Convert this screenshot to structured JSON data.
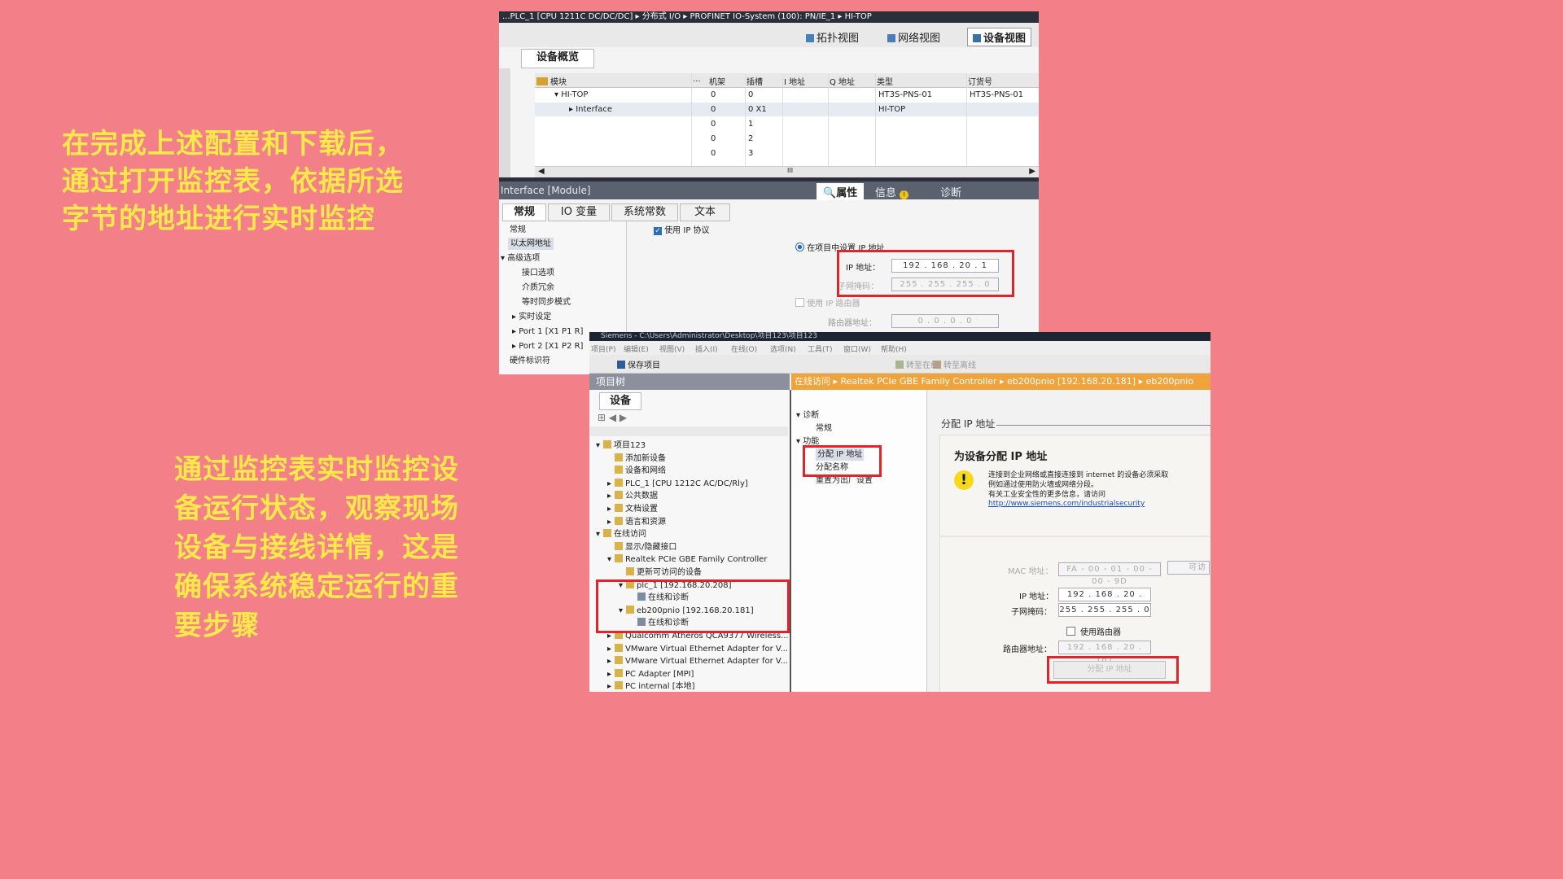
{
  "left_text_top": [
    "在完成上述配置和下载后，",
    "通过打开监控表，依据所选",
    "字节的地址进行实时监控"
  ],
  "left_text_bottom": [
    "通过监控表实时监控设",
    "备运行状态，观察现场",
    "设备与接线详情，这是",
    "确保系统稳定运行的重",
    "要步骤"
  ],
  "colors": {
    "background": "#f37f88",
    "text": "#ffe94a",
    "highlight": "#e0252a",
    "toolbar_bar": "#f0a33a"
  },
  "screen1": {
    "breadcrumb": "...PLC_1 [CPU 1211C DC/DC/DC] ▸ 分布式 I/O ▸ PROFINET IO-System (100): PN/IE_1 ▸ HI-TOP",
    "view_buttons": [
      "拓扑视图",
      "网络视图",
      "设备视图"
    ],
    "overview_tab": "设备概览",
    "columns": [
      "模块",
      "...",
      "机架",
      "插槽",
      "I 地址",
      "Q 地址",
      "类型",
      "订货号"
    ],
    "rows": [
      {
        "module": "HI-TOP",
        "rack": "0",
        "slot": "0",
        "type": "HT3S-PNS-01",
        "order": "HT3S-PNS-01"
      },
      {
        "module": "Interface",
        "rack": "0",
        "slot": "0 X1",
        "type": "HI-TOP",
        "order": ""
      },
      {
        "module": "",
        "rack": "0",
        "slot": "1",
        "type": "",
        "order": ""
      },
      {
        "module": "",
        "rack": "0",
        "slot": "2",
        "type": "",
        "order": ""
      },
      {
        "module": "",
        "rack": "0",
        "slot": "3",
        "type": "",
        "order": ""
      }
    ],
    "scroll_mark": "III",
    "inspector_title": "Interface [Module]",
    "inspector_tabs": [
      "属性",
      "信息",
      "诊断"
    ],
    "prop_tabs": [
      "常规",
      "IO 变量",
      "系统常数",
      "文本"
    ],
    "nav": [
      "常规",
      "以太网地址",
      "高级选项",
      "接口选项",
      "介质冗余",
      "等时同步模式",
      "实时设定",
      "Port 1 [X1 P1 R]",
      "Port 2 [X1 P2 R]",
      "硬件标识符"
    ],
    "use_ip_protocol": "使用 IP 协议",
    "set_ip_in_project": "在项目中设置 IP 地址",
    "ip_label": "IP 地址：",
    "ip_value": "192 . 168 . 20 . 1",
    "subnet_label": "子网掩码：",
    "subnet_value": "255 . 255 . 255 . 0",
    "use_router": "使用 IP 路由器",
    "router_label": "路由器地址：",
    "router_value": "0 . 0 . 0 . 0"
  },
  "screen2": {
    "titlebar": "Siemens - C:\\Users\\Administrator\\Desktop\\项目123\\项目123",
    "menu": [
      "项目(P)",
      "编辑(E)",
      "视图(V)",
      "插入(I)",
      "在线(O)",
      "选项(N)",
      "工具(T)",
      "窗口(W)",
      "帮助(H)"
    ],
    "toolbar_labels": [
      "保存项目",
      "转至在线",
      "转至离线"
    ],
    "project_tree_title": "项目树",
    "devices_tab": "设备",
    "tree": [
      {
        "label": "项目123",
        "indent": 1
      },
      {
        "label": "添加新设备",
        "indent": 2
      },
      {
        "label": "设备和网络",
        "indent": 2
      },
      {
        "label": "PLC_1 [CPU 1212C AC/DC/Rly]",
        "indent": 2
      },
      {
        "label": "公共数据",
        "indent": 2
      },
      {
        "label": "文档设置",
        "indent": 2
      },
      {
        "label": "语言和资源",
        "indent": 2
      },
      {
        "label": "在线访问",
        "indent": 1
      },
      {
        "label": "显示/隐藏接口",
        "indent": 2
      },
      {
        "label": "Realtek PCIe GBE Family Controller",
        "indent": 2
      },
      {
        "label": "更新可访问的设备",
        "indent": 3
      },
      {
        "label": "plc_1 [192.168.20.208]",
        "indent": 3
      },
      {
        "label": "在线和诊断",
        "indent": 4
      },
      {
        "label": "eb200pnio [192.168.20.181]",
        "indent": 3
      },
      {
        "label": "在线和诊断",
        "indent": 4
      },
      {
        "label": "Qualcomm Atheros QCA9377 Wireless...",
        "indent": 2
      },
      {
        "label": "VMware Virtual Ethernet Adapter for V...",
        "indent": 2
      },
      {
        "label": "VMware Virtual Ethernet Adapter for V...",
        "indent": 2
      },
      {
        "label": "PC Adapter [MPI]",
        "indent": 2
      },
      {
        "label": "PC internal [本地]",
        "indent": 2
      }
    ],
    "orange_breadcrumb": "在线访问 ▸ Realtek PCIe GBE Family Controller ▸ eb200pnio [192.168.20.181] ▸ eb200pnio",
    "diag_nav": [
      "诊断",
      "常规",
      "功能",
      "分配 IP 地址",
      "分配名称",
      "重置为出厂设置"
    ],
    "section_title": "分配 IP 地址",
    "panel_title": "为设备分配 IP 地址",
    "warning_lines": [
      "连接到企业网络或直接连接到 internet 的设备必须采取",
      "例如通过使用防火墙或网络分段。",
      "有关工业安全性的更多信息，请访问"
    ],
    "link": "http://www.siemens.com/industrialsecurity",
    "mac_label": "MAC 地址：",
    "mac_value": "FA - 00 - 01 - 00 - 00 - 9D",
    "accessible_btn": "可访",
    "ip_label": "IP 地址：",
    "ip_value": "192 . 168 . 20 . 181",
    "subnet_label": "子网掩码：",
    "subnet_value": "255 . 255 . 255 . 0",
    "use_router": "使用路由器",
    "router_label": "路由器地址：",
    "router_value": "192 . 168 . 20 . 181",
    "assign_btn": "分配 IP 地址"
  }
}
